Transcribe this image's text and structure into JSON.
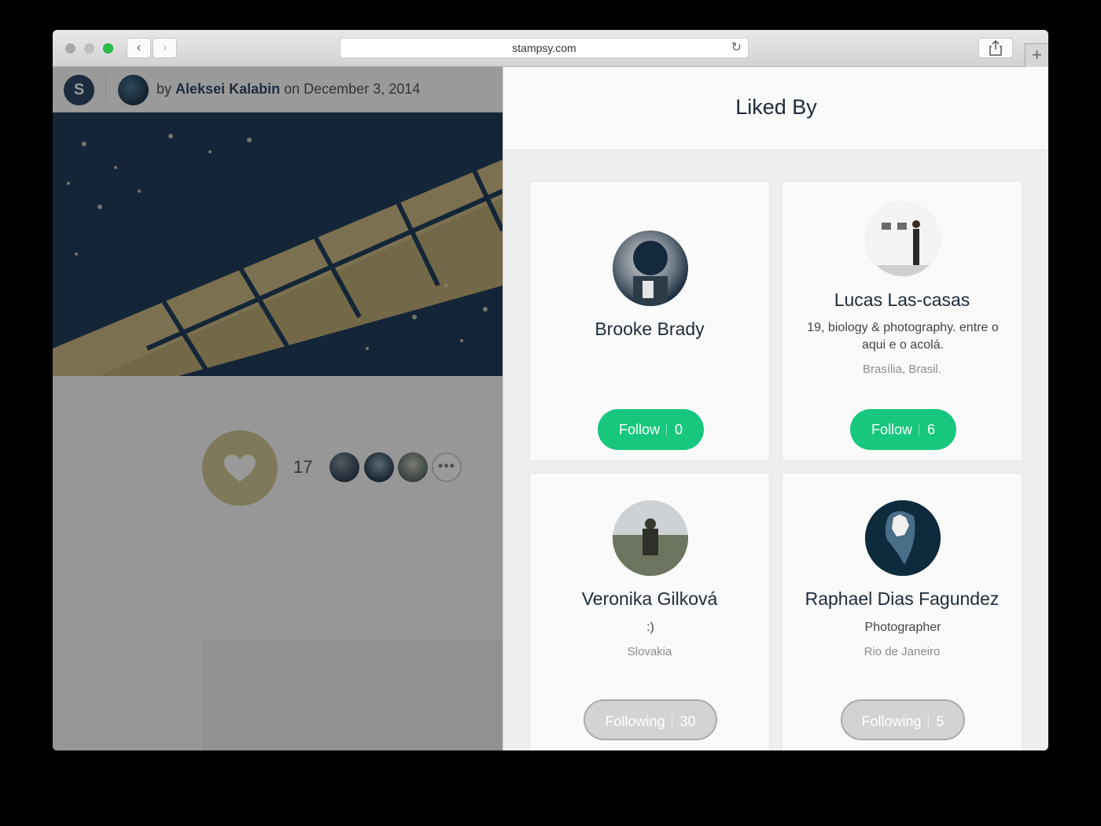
{
  "browser": {
    "url": "stampsy.com",
    "back_glyph": "‹",
    "forward_glyph": "›",
    "reload_glyph": "↻",
    "new_tab_glyph": "+",
    "share_glyph": "⇪"
  },
  "post": {
    "logo_letter": "S",
    "by_label": "by",
    "author": "Aleksei Kalabin",
    "on_label": "on",
    "date": "December 3, 2014",
    "like_count": "17",
    "more_label": "•••"
  },
  "liked_by": {
    "title": "Liked By",
    "users": [
      {
        "name": "Brooke Brady",
        "bio": "",
        "location": "",
        "button": "Follow",
        "count": "0",
        "state": "follow"
      },
      {
        "name": "Lucas Las-casas",
        "bio": "19, biology & photography. entre o aqui e o acolá.",
        "location": "Brasília, Brasil.",
        "button": "Follow",
        "count": "6",
        "state": "follow"
      },
      {
        "name": "Veronika Gilková",
        "bio": ":)",
        "location": "Slovakia",
        "button": "Following",
        "count": "30",
        "state": "following"
      },
      {
        "name": "Raphael Dias Fagundez",
        "bio": "Photographer",
        "location": "Rio de Janeiro",
        "button": "Following",
        "count": "5",
        "state": "following"
      }
    ]
  },
  "colors": {
    "follow_green": "#17c77e",
    "brand_navy": "#1b3556",
    "heart_tan": "#cdc38b"
  }
}
